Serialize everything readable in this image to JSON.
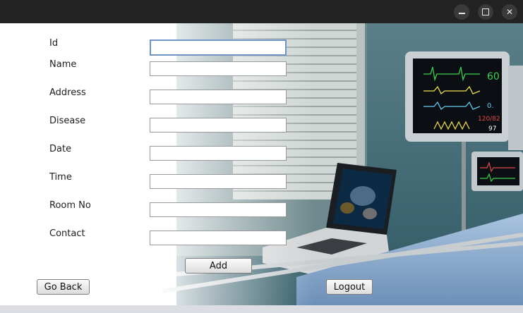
{
  "window": {
    "controls": {
      "minimize_icon": "minimize-icon",
      "maximize_icon": "maximize-icon",
      "close_icon": "close-icon",
      "close_glyph": "✕"
    }
  },
  "form": {
    "fields": [
      {
        "label": "Id",
        "value": "",
        "focused": true
      },
      {
        "label": "Name",
        "value": ""
      },
      {
        "label": "Address",
        "value": ""
      },
      {
        "label": "Disease",
        "value": ""
      },
      {
        "label": "Date",
        "value": ""
      },
      {
        "label": "Time",
        "value": ""
      },
      {
        "label": "Room No",
        "value": ""
      },
      {
        "label": "Contact",
        "value": ""
      }
    ]
  },
  "buttons": {
    "add": "Add",
    "go_back": "Go Back",
    "logout": "Logout"
  },
  "background_image": {
    "monitor_readings": [
      "60",
      "97",
      "120/82",
      "0."
    ]
  },
  "colors": {
    "titlebar": "#232323",
    "focus_border": "#6f93c2",
    "wall": "#3f6b78"
  }
}
